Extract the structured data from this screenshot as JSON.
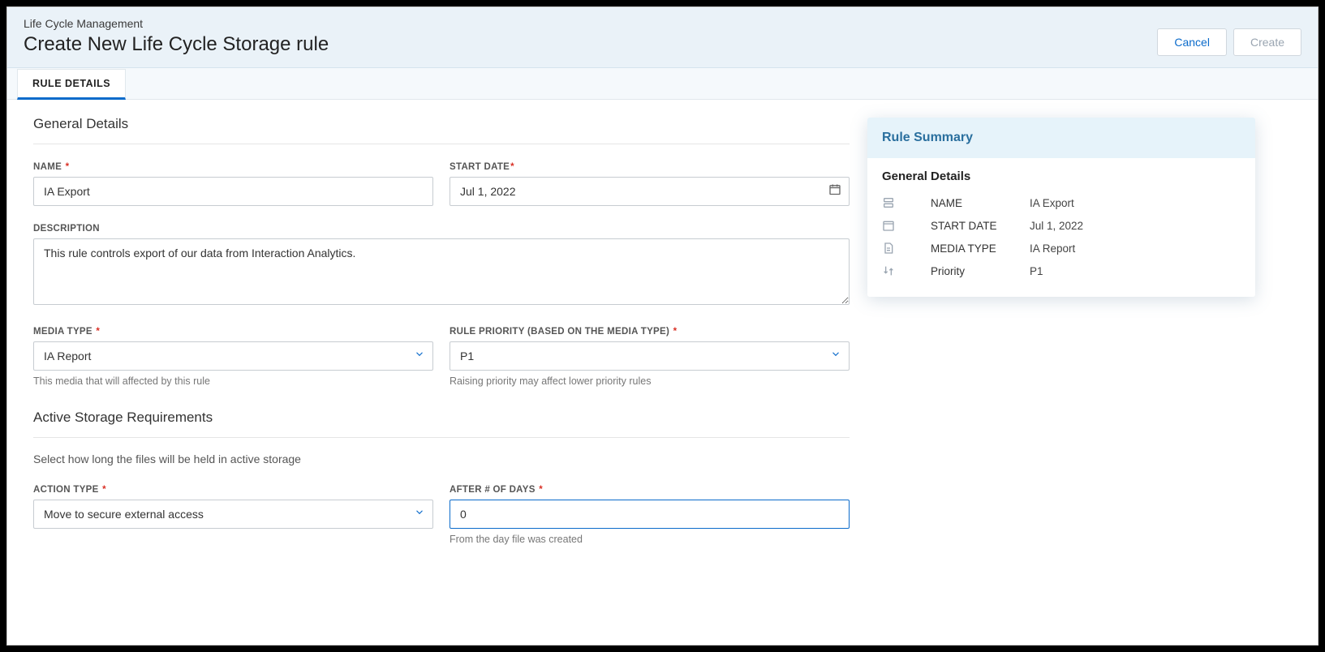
{
  "header": {
    "breadcrumb": "Life Cycle Management",
    "title": "Create New Life Cycle Storage rule",
    "cancel": "Cancel",
    "create": "Create"
  },
  "tabs": {
    "rule_details": "RULE DETAILS"
  },
  "general": {
    "section": "General Details",
    "name_label": "NAME",
    "name_value": "IA Export",
    "start_date_label": "START DATE",
    "start_date_value": "Jul 1, 2022",
    "description_label": "DESCRIPTION",
    "description_value": "This rule controls export of our data from Interaction Analytics.",
    "media_type_label": "MEDIA TYPE",
    "media_type_value": "IA Report",
    "media_type_helper": "This media that will affected by this rule",
    "rule_priority_label": "RULE PRIORITY (BASED ON THE MEDIA TYPE)",
    "rule_priority_value": "P1",
    "rule_priority_helper": "Raising priority may affect lower priority rules"
  },
  "active_storage": {
    "section": "Active Storage Requirements",
    "subtitle": "Select how long the files will be held in active storage",
    "action_type_label": "ACTION TYPE",
    "action_type_value": "Move to secure external access",
    "after_days_label": "AFTER # OF DAYS",
    "after_days_value": "0",
    "after_days_helper": "From the day file was created"
  },
  "summary": {
    "title": "Rule Summary",
    "section": "General Details",
    "rows": {
      "name_label": "NAME",
      "name_value": "IA Export",
      "start_label": "START DATE",
      "start_value": "Jul 1, 2022",
      "media_label": "MEDIA TYPE",
      "media_value": "IA Report",
      "priority_label": "Priority",
      "priority_value": "P1"
    }
  }
}
